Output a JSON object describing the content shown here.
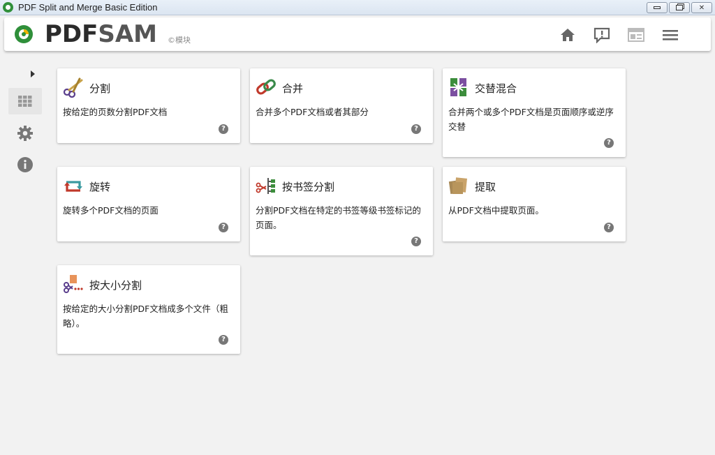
{
  "window": {
    "title": "PDF Split and Merge Basic Edition"
  },
  "header": {
    "logo_main": "PDF",
    "logo_sam": "SAM",
    "logo_sub": "©模块",
    "icons": [
      "home-icon",
      "feedback-icon",
      "news-icon",
      "menu-icon"
    ]
  },
  "sidebar": {
    "items": [
      "modules-grid-icon",
      "settings-icon",
      "info-icon"
    ]
  },
  "modules": [
    {
      "title": "分割",
      "desc": "按给定的页数分割PDF文档",
      "help": "?"
    },
    {
      "title": "合并",
      "desc": "合并多个PDF文档或者其部分",
      "help": "?"
    },
    {
      "title": "交替混合",
      "desc": "合并两个或多个PDF文档是页面顺序或逆序交替",
      "help": "?"
    },
    {
      "title": "旋转",
      "desc": "旋转多个PDF文档的页面",
      "help": "?"
    },
    {
      "title": "按书签分割",
      "desc": "分割PDF文档在特定的书签等级书签标记的页面。",
      "help": "?"
    },
    {
      "title": "提取",
      "desc": "从PDF文档中提取页面。",
      "help": "?"
    },
    {
      "title": "按大小分割",
      "desc": "按给定的大小分割PDF文档成多个文件（粗略）。",
      "help": "?"
    }
  ],
  "colors": {
    "accent_green": "#2f8f3a",
    "icon_gray": "#555555"
  }
}
